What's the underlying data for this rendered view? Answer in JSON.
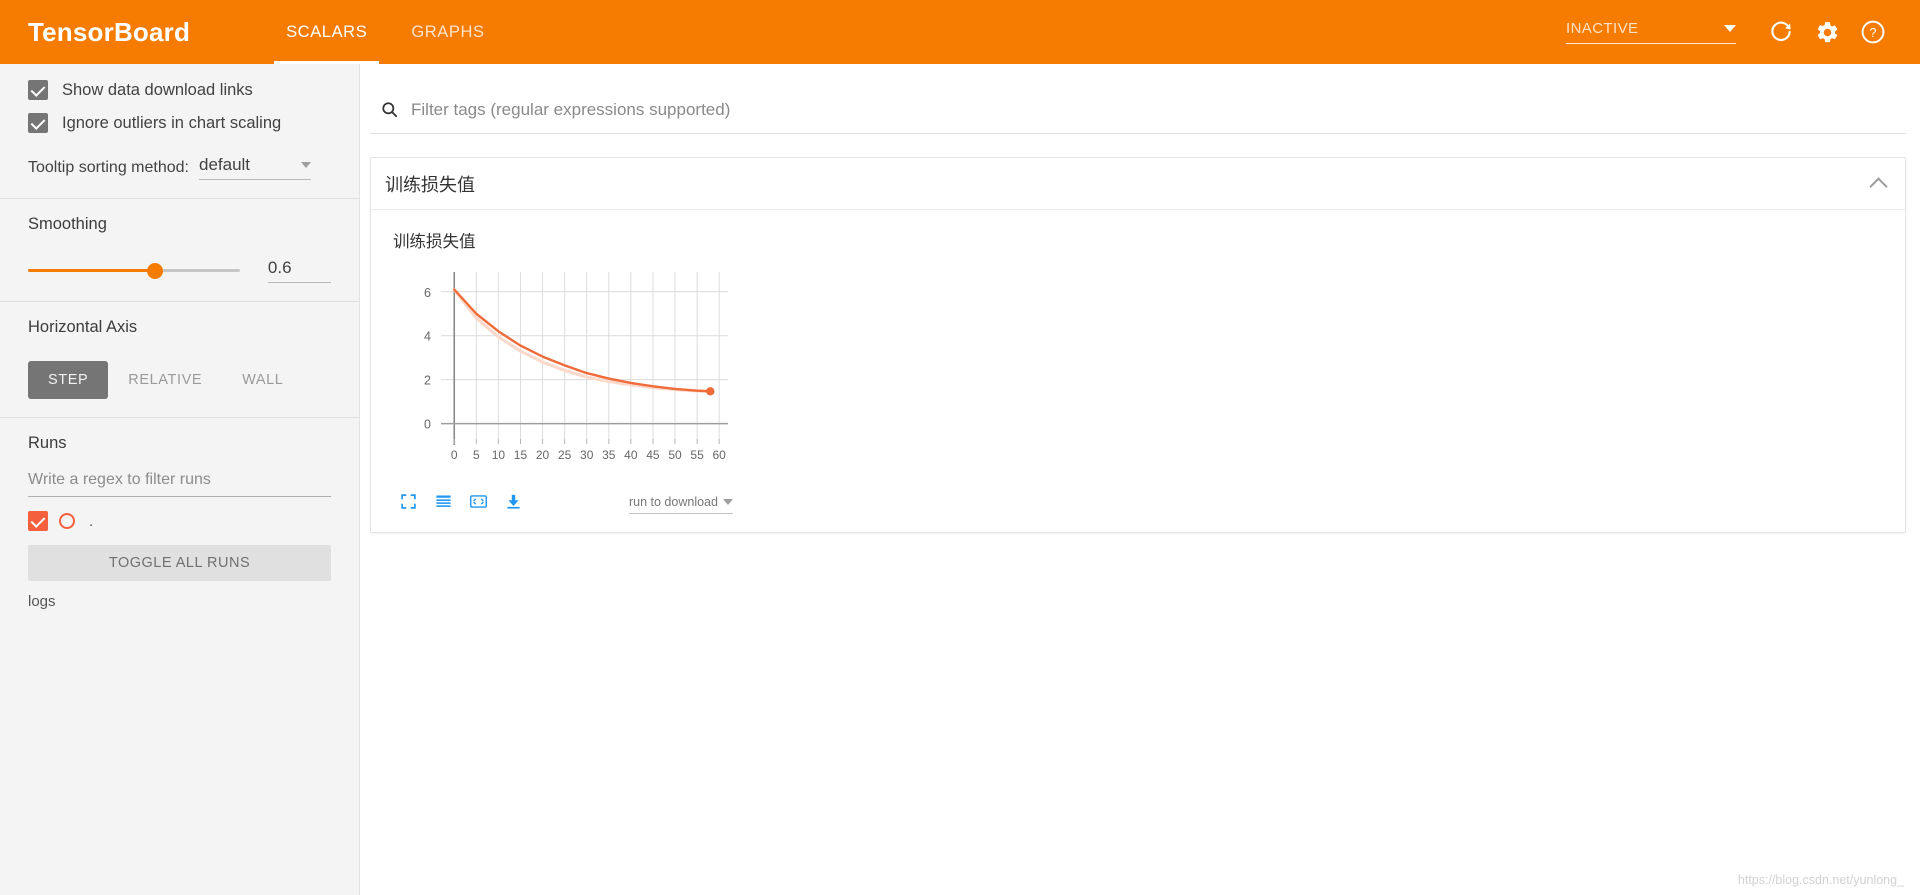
{
  "header": {
    "brand": "TensorBoard",
    "tabs": [
      {
        "label": "SCALARS",
        "active": true
      },
      {
        "label": "GRAPHS",
        "active": false
      }
    ],
    "run_selector_value": "INACTIVE",
    "icons": [
      "refresh-icon",
      "gear-icon",
      "help-icon"
    ]
  },
  "sidebar": {
    "checkboxes": [
      {
        "label": "Show data download links",
        "checked": true
      },
      {
        "label": "Ignore outliers in chart scaling",
        "checked": true
      }
    ],
    "tooltip_sorting": {
      "label": "Tooltip sorting method:",
      "value": "default"
    },
    "smoothing": {
      "title": "Smoothing",
      "value": "0.6",
      "percent": 60
    },
    "horizontal_axis": {
      "title": "Horizontal Axis",
      "options": [
        {
          "label": "STEP",
          "active": true
        },
        {
          "label": "RELATIVE",
          "active": false
        },
        {
          "label": "WALL",
          "active": false
        }
      ]
    },
    "runs": {
      "title": "Runs",
      "filter_placeholder": "Write a regex to filter runs",
      "items": [
        {
          "name": ".",
          "checked": true,
          "color": "#f4603e"
        }
      ],
      "toggle_all_label": "TOGGLE ALL RUNS",
      "logs_label": "logs"
    }
  },
  "main": {
    "search_placeholder": "Filter tags (regular expressions supported)",
    "card": {
      "title": "训练损失值",
      "chart_title": "训练损失值",
      "download_select_value": "run to download",
      "tools": [
        "fit-domain-icon",
        "data-table-icon",
        "expand-icon",
        "download-icon"
      ]
    }
  },
  "watermark": "https://blog.csdn.net/yunlong_",
  "colors": {
    "brand": "#f57c00",
    "series": "#ef6c3a",
    "series_light": "#fbd9cb",
    "tool_blue": "#2196f3",
    "run_accent": "#f4603e"
  },
  "chart_data": {
    "type": "line",
    "title": "训练损失值",
    "xlabel": "",
    "ylabel": "",
    "xlim": [
      -3,
      62
    ],
    "ylim": [
      -0.7,
      6.9
    ],
    "xticks": [
      0,
      5,
      10,
      15,
      20,
      25,
      30,
      35,
      40,
      45,
      50,
      55,
      60
    ],
    "yticks": [
      0,
      2,
      4,
      6
    ],
    "grid": true,
    "legend": false,
    "series": [
      {
        "name": "smoothed",
        "color": "#ef6c3a",
        "x": [
          0,
          5,
          10,
          15,
          20,
          25,
          30,
          35,
          40,
          45,
          50,
          55,
          58
        ],
        "values": [
          6.1,
          5.0,
          4.2,
          3.55,
          3.05,
          2.65,
          2.3,
          2.05,
          1.85,
          1.7,
          1.58,
          1.5,
          1.47
        ]
      },
      {
        "name": "raw",
        "color": "#fbd9cb",
        "x": [
          0,
          5,
          10,
          15,
          20,
          25,
          30,
          35,
          40,
          45,
          50,
          55,
          58
        ],
        "values": [
          6.1,
          4.8,
          3.95,
          3.3,
          2.8,
          2.42,
          2.12,
          1.92,
          1.76,
          1.64,
          1.55,
          1.49,
          1.47
        ]
      }
    ],
    "marker": {
      "x": 58,
      "y": 1.47,
      "color": "#ef6c3a"
    }
  }
}
